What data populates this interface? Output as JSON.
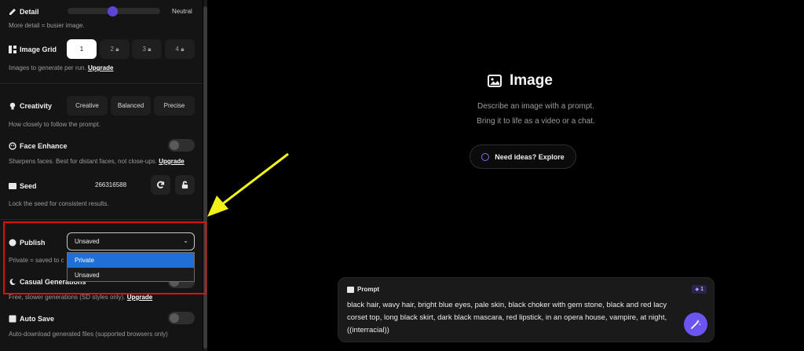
{
  "sidebar": {
    "detail": {
      "label": "Detail",
      "value": "Neutral",
      "help": "More detail = busier image.",
      "level": 0.5
    },
    "image_grid": {
      "label": "Image Grid",
      "options": [
        "1",
        "2",
        "3",
        "4"
      ],
      "selected": "1",
      "help": "Images to generate per run.",
      "link": "Upgrade"
    },
    "creativity": {
      "label": "Creativity",
      "options": [
        "Creative",
        "Balanced",
        "Precise"
      ],
      "help": "How closely to follow the prompt."
    },
    "face_enhance": {
      "label": "Face Enhance",
      "help": "Sharpens faces. Best for distant faces, not close-ups.",
      "link": "Upgrade",
      "enabled": false
    },
    "seed": {
      "label": "Seed",
      "value": "266316588",
      "help": "Lock the seed for consistent results."
    },
    "publish": {
      "label": "Publish",
      "selected": "Unsaved",
      "options": [
        "Private",
        "Unsaved"
      ],
      "help": "Private = saved to c"
    },
    "casual": {
      "label": "Casual Generations",
      "help": "Free, slower generations (SD styles only).",
      "link": "Upgrade"
    },
    "auto_save": {
      "label": "Auto Save",
      "help": "Auto-download generated files (supported browsers only)",
      "enabled": false
    }
  },
  "main": {
    "title": "Image",
    "line1": "Describe an image with a prompt.",
    "line2": "Bring it to life as a video or a chat.",
    "explore_label": "Need ideas? Explore",
    "prompt": {
      "label": "Prompt",
      "credits": "1",
      "text": "black hair, wavy hair, bright blue eyes, pale skin, black choker with gem stone, black and red lacy corset top, long black skirt, dark black mascara, red lipstick, in an opera house, vampire, at night, ((interracial))"
    }
  },
  "colors": {
    "accent": "#5b45d6",
    "annotation_box": "#e0100f",
    "annotation_arrow": "#f2f21a",
    "dropdown_highlight": "#1f6fd6"
  },
  "icons": [
    "pen-icon",
    "grid-icon",
    "bulb-icon",
    "face-icon",
    "image-icon",
    "refresh-icon",
    "lock-icon",
    "globe-icon",
    "moon-icon",
    "save-icon",
    "compass-icon",
    "wand-icon",
    "gem-icon",
    "prompt-icon"
  ]
}
